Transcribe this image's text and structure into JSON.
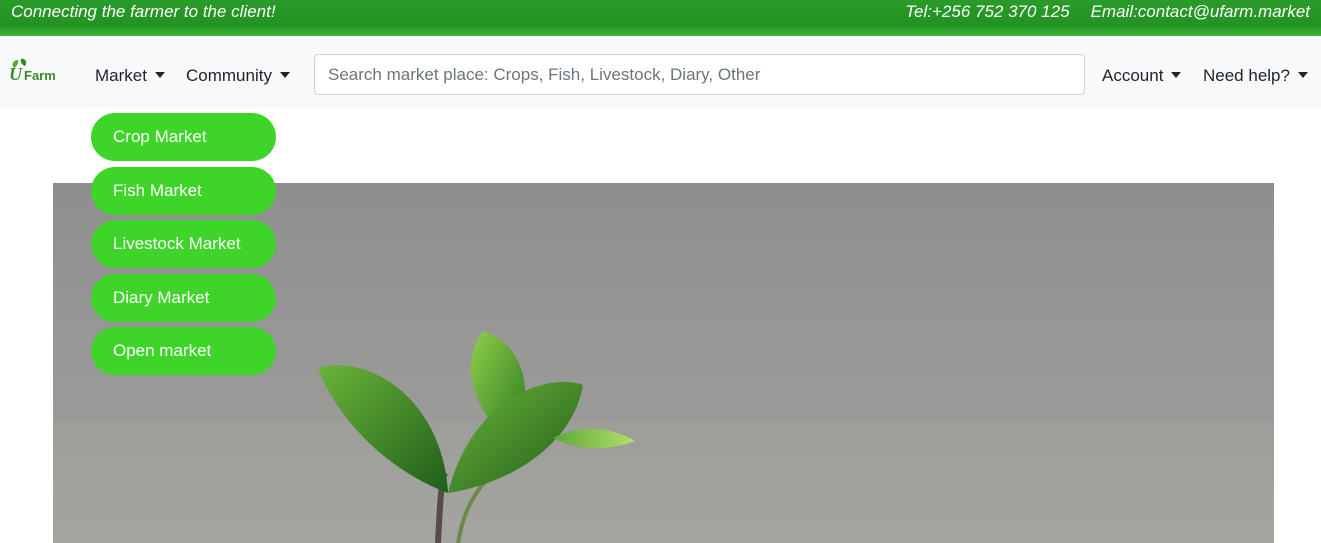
{
  "topbar": {
    "tagline": "Connecting the farmer to the client!",
    "phone": "Tel:+256 752 370 125",
    "email": "Email:contact@ufarm.market"
  },
  "brand": {
    "logo_text": "UFarm",
    "logo_color": "#3a8a2a"
  },
  "nav": {
    "market_label": "Market",
    "community_label": "Community",
    "account_label": "Account",
    "help_label": "Need help?"
  },
  "search": {
    "placeholder": "Search market place: Crops, Fish, Livestock, Diary, Other",
    "value": ""
  },
  "market_dropdown": {
    "items": [
      {
        "label": "Crop Market"
      },
      {
        "label": "Fish Market"
      },
      {
        "label": "Livestock Market"
      },
      {
        "label": "Diary Market"
      },
      {
        "label": "Open market"
      }
    ]
  },
  "colors": {
    "topbar": "#229322",
    "dropdown_item": "#3ed42a",
    "navbar_bg": "#f8f9fa"
  },
  "icons": {
    "caret": "caret-down-icon"
  }
}
